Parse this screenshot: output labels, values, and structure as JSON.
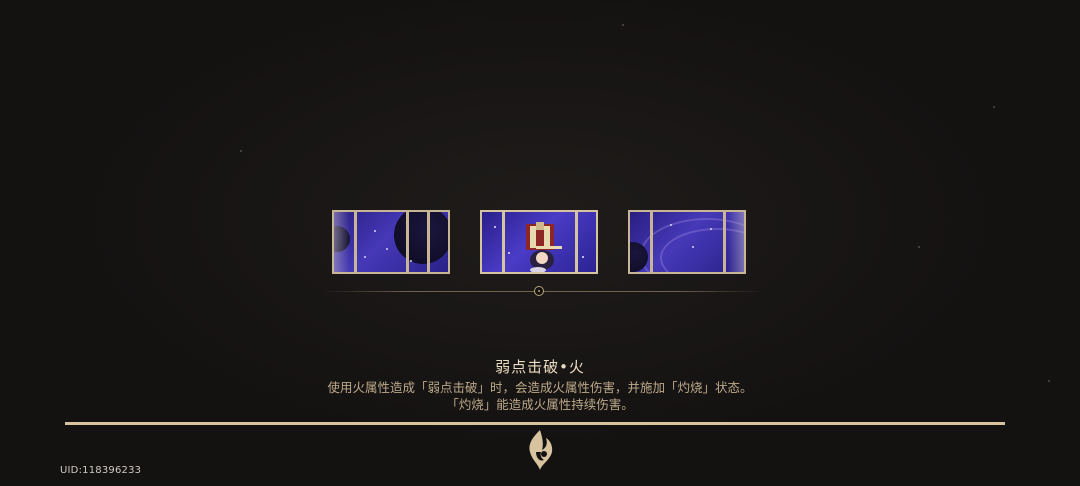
{
  "skill": {
    "title": "弱点击破•火",
    "description_line1": "使用火属性造成「弱点击破」时，会造成火属性伤害，并施加「灼烧」状态。",
    "description_line2": "「灼烧」能造成火属性持续伤害。"
  },
  "footer": {
    "uid": "UID:118396233"
  },
  "panels": [
    {
      "name": "space-scene-left",
      "icon": "planet-icon"
    },
    {
      "name": "space-scene-center",
      "icon": "character-icon"
    },
    {
      "name": "space-scene-right",
      "icon": "swirl-icon"
    }
  ],
  "colors": {
    "background": "#141211",
    "gold": "#d7c39e",
    "title_text": "#eadcc0",
    "body_text": "#bca98a",
    "panel_space": "#3b2fb0"
  }
}
